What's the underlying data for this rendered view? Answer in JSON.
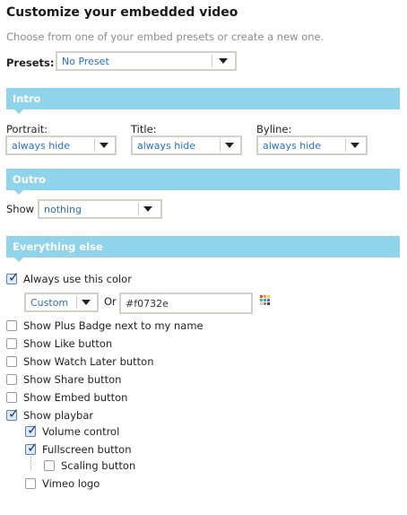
{
  "header": {
    "title": "Customize your embedded video",
    "subtitle": "Choose from one of your embed presets or create a new one."
  },
  "presets": {
    "label": "Presets:",
    "value": "No Preset"
  },
  "intro": {
    "heading": "Intro",
    "portrait": {
      "label": "Portrait:",
      "value": "always hide"
    },
    "title": {
      "label": "Title:",
      "value": "always hide"
    },
    "byline": {
      "label": "Byline:",
      "value": "always hide"
    }
  },
  "outro": {
    "heading": "Outro",
    "show_label": "Show",
    "show_value": "nothing"
  },
  "everything": {
    "heading": "Everything else",
    "color_checkbox": {
      "label": "Always use this color",
      "checked": true
    },
    "color_select": "Custom",
    "or_label": "Or",
    "color_value": "#f0732e",
    "options": [
      {
        "label": "Show Plus Badge next to my name",
        "checked": false
      },
      {
        "label": "Show Like button",
        "checked": false
      },
      {
        "label": "Show Watch Later button",
        "checked": false
      },
      {
        "label": "Show Share button",
        "checked": false
      },
      {
        "label": "Show Embed button",
        "checked": false
      },
      {
        "label": "Show playbar",
        "checked": true
      }
    ],
    "playbar": {
      "volume": {
        "label": "Volume control",
        "checked": true
      },
      "fullscreen": {
        "label": "Fullscreen button",
        "checked": true
      },
      "scaling": {
        "label": "Scaling button",
        "checked": false
      },
      "vimeo_logo": {
        "label": "Vimeo logo",
        "checked": false
      }
    }
  },
  "colors": {
    "accent_bar": "#8fd4ea",
    "link": "#2b6fc0",
    "field_border": "#d3d1c7"
  },
  "icons": {
    "color_picker": "color-grid-icon",
    "dropdown": "chevron-down-icon",
    "check": "checkmark-icon"
  }
}
